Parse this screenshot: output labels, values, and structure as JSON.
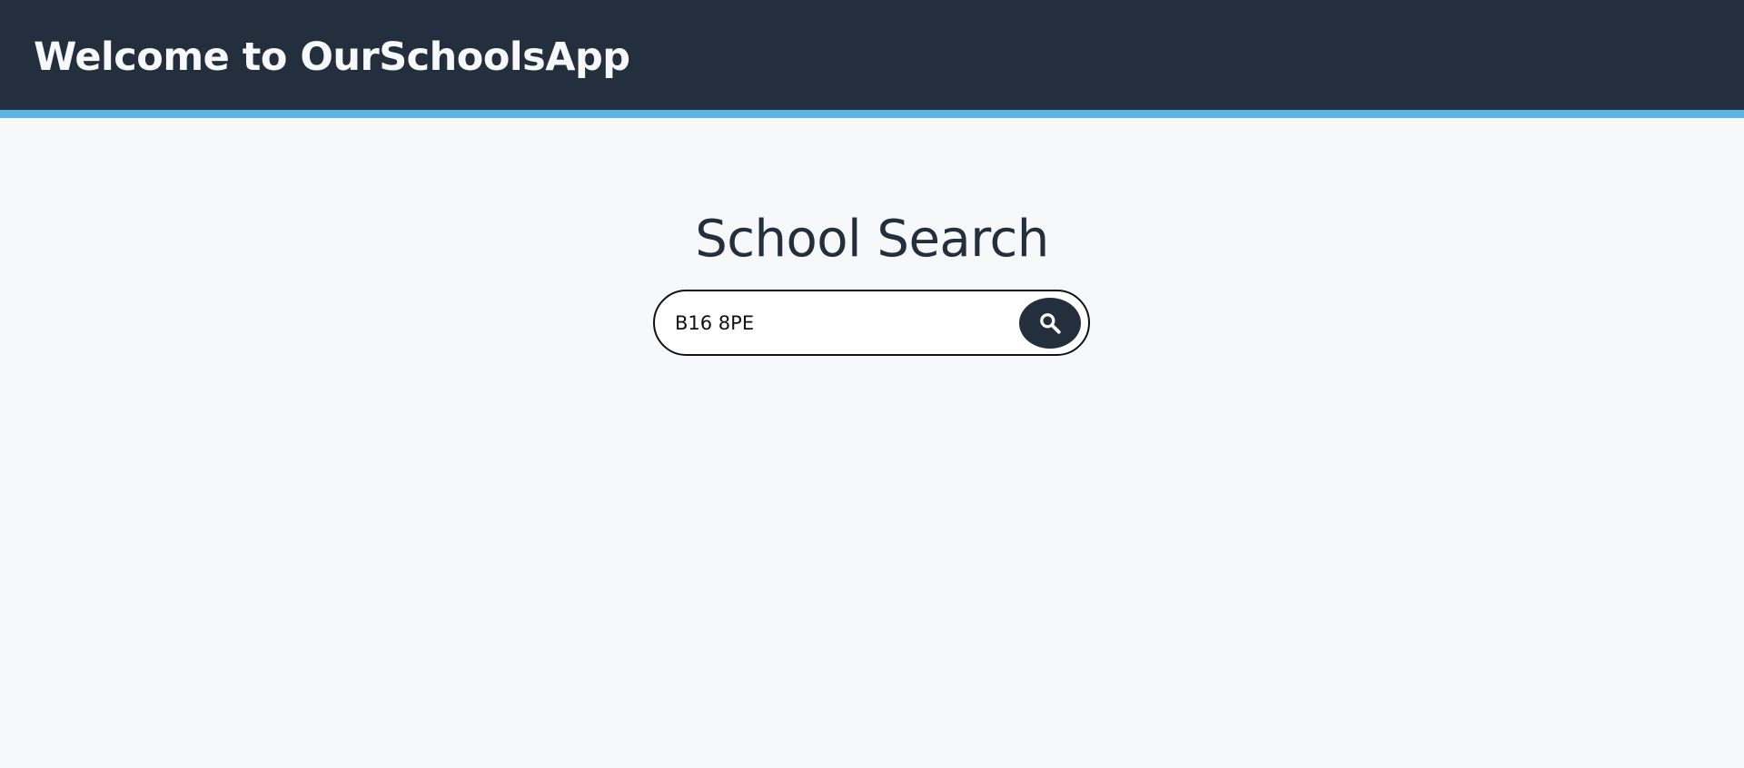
{
  "header": {
    "title": "Welcome to OurSchoolsApp"
  },
  "main": {
    "title": "School Search",
    "search": {
      "value": "B16 8PE",
      "placeholder": "",
      "button_icon": "search-icon"
    }
  },
  "colors": {
    "header_background": "#232f3d",
    "header_accent": "#5ab4e6",
    "page_background": "#f6f8fa",
    "button_background": "#232f3d"
  }
}
